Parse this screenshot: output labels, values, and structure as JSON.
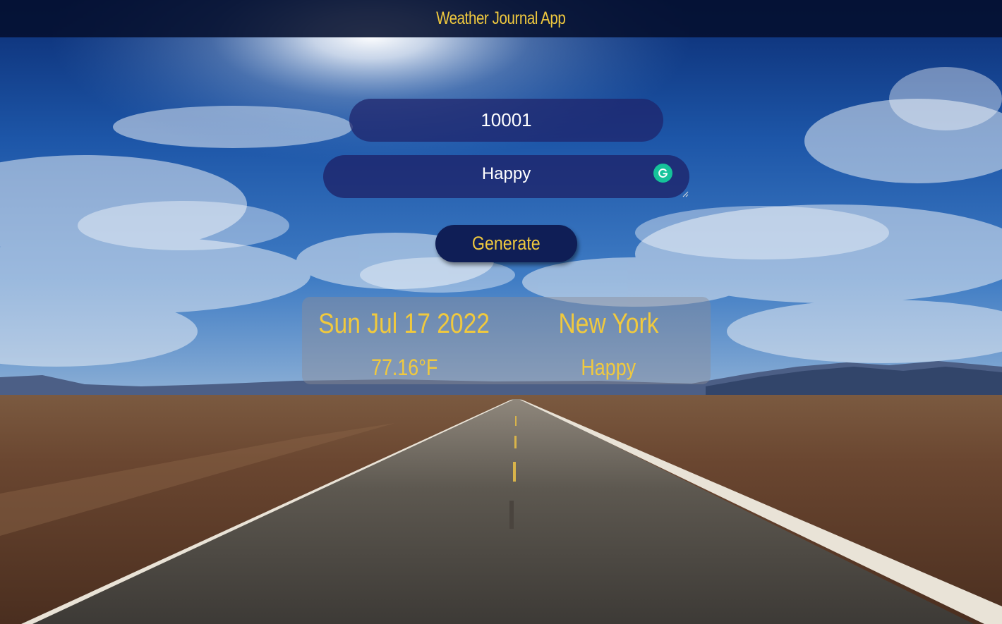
{
  "header": {
    "title": "Weather Journal App"
  },
  "form": {
    "zip_value": "10001",
    "feelings_value": "Happy",
    "generate_label": "Generate"
  },
  "entry": {
    "date": "Sun Jul 17 2022",
    "city": "New York",
    "temp": "77.16°F",
    "content": "Happy"
  },
  "colors": {
    "accent": "#f0c93e",
    "header_bg": "#050f2d",
    "button_bg": "#0f1e56",
    "grammarly": "#15c39a"
  },
  "icons": {
    "grammarly": "grammarly-icon",
    "resize": "resize-handle-icon"
  }
}
